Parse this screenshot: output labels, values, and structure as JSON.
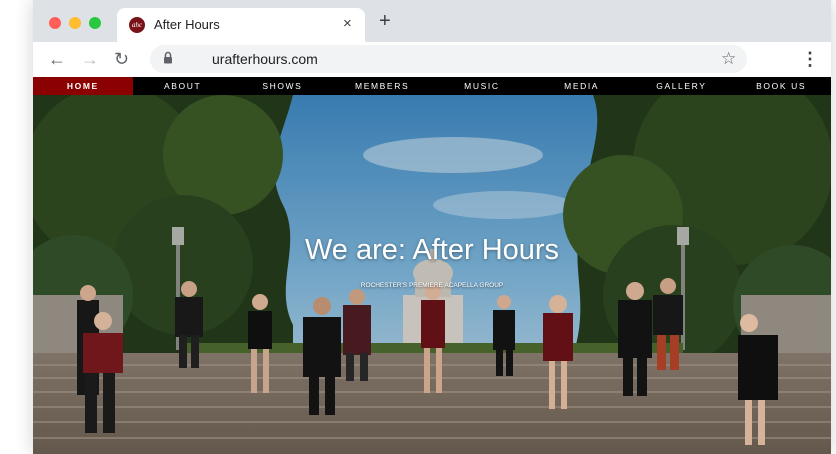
{
  "browser": {
    "tab_title": "After Hours",
    "tab_close": "×",
    "new_tab": "+",
    "favicon_text": "ahc",
    "back": "←",
    "forward": "→",
    "reload": "↻",
    "url": "urafterhours.com",
    "bookmark": "☆",
    "menu": "⋮"
  },
  "nav": {
    "items": [
      "HOME",
      "ABOUT",
      "SHOWS",
      "MEMBERS",
      "MUSIC",
      "MEDIA",
      "GALLERY",
      "BOOK US"
    ],
    "active_index": 0
  },
  "hero": {
    "title": "We are: After Hours",
    "subtitle": "ROCHESTER'S PREMIERE ACAPELLA GROUP"
  },
  "colors": {
    "accent": "#8b0000",
    "nav_bg": "#000000",
    "tabstrip": "#dee1e6",
    "close": "#ff5f57",
    "minimize": "#febc2e",
    "maximize": "#28c840"
  }
}
